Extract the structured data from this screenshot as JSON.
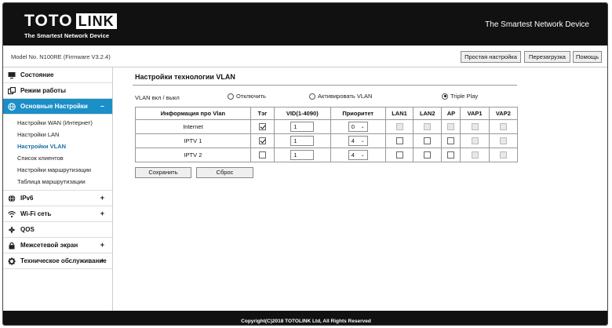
{
  "header": {
    "logo_left": "TOTO",
    "logo_right": "LINK",
    "logo_tagline": "The Smartest Network Device",
    "slogan": "The Smartest Network Device"
  },
  "model_bar": {
    "model_text": "Model No. N100RE (Firmware V3.2.4)",
    "buttons": [
      "Простая настройка",
      "Перезагрузка",
      "Помощь"
    ]
  },
  "sidebar": {
    "status": "Состояние",
    "mode": "Режим работы",
    "basic": "Основные Настройки",
    "basic_toggle": "–",
    "basic_sub": [
      "Настройки WAN (Интернет)",
      "Настройки LAN",
      "Настройки VLAN",
      "Список клиентов",
      "Настройки маршрутизации",
      "Таблица маршрутизации"
    ],
    "ipv6": "IPv6",
    "wifi": "Wi-Fi сеть",
    "qos": "QOS",
    "firewall": "Межсетевой экран",
    "maintenance": "Техническое обслуживание",
    "plus": "+"
  },
  "content": {
    "title": "Настройки технологии VLAN",
    "vlan_label": "VLAN вкл / выкл",
    "radio_off": "Отключить",
    "radio_on": "Активировать VLAN",
    "radio_triple": "Triple Play",
    "selected_mode": "Triple Play",
    "table": {
      "headers": [
        "Информация про Vlan",
        "Тэг",
        "VID(1-4090)",
        "Приоритет",
        "LAN1",
        "LAN2",
        "AP",
        "VAP1",
        "VAP2"
      ],
      "rows": [
        {
          "name": "Internet",
          "tag": true,
          "vid": "1",
          "priority": "0",
          "lan1": false,
          "lan2": false,
          "ap": false,
          "vap1": false,
          "vap2": false,
          "lan_disabled": true
        },
        {
          "name": "IPTV 1",
          "tag": true,
          "vid": "1",
          "priority": "4",
          "lan1": false,
          "lan2": false,
          "ap": false,
          "vap1": false,
          "vap2": false,
          "lan_disabled": false
        },
        {
          "name": "IPTV 2",
          "tag": false,
          "vid": "1",
          "priority": "4",
          "lan1": false,
          "lan2": false,
          "ap": false,
          "vap1": false,
          "vap2": false,
          "lan_disabled": false
        }
      ]
    },
    "save": "Сохранить",
    "reset": "Сброс"
  },
  "footer": {
    "copyright": "Copyright(C)2018 TOTOLINK Ltd, All Rights Reserved"
  }
}
